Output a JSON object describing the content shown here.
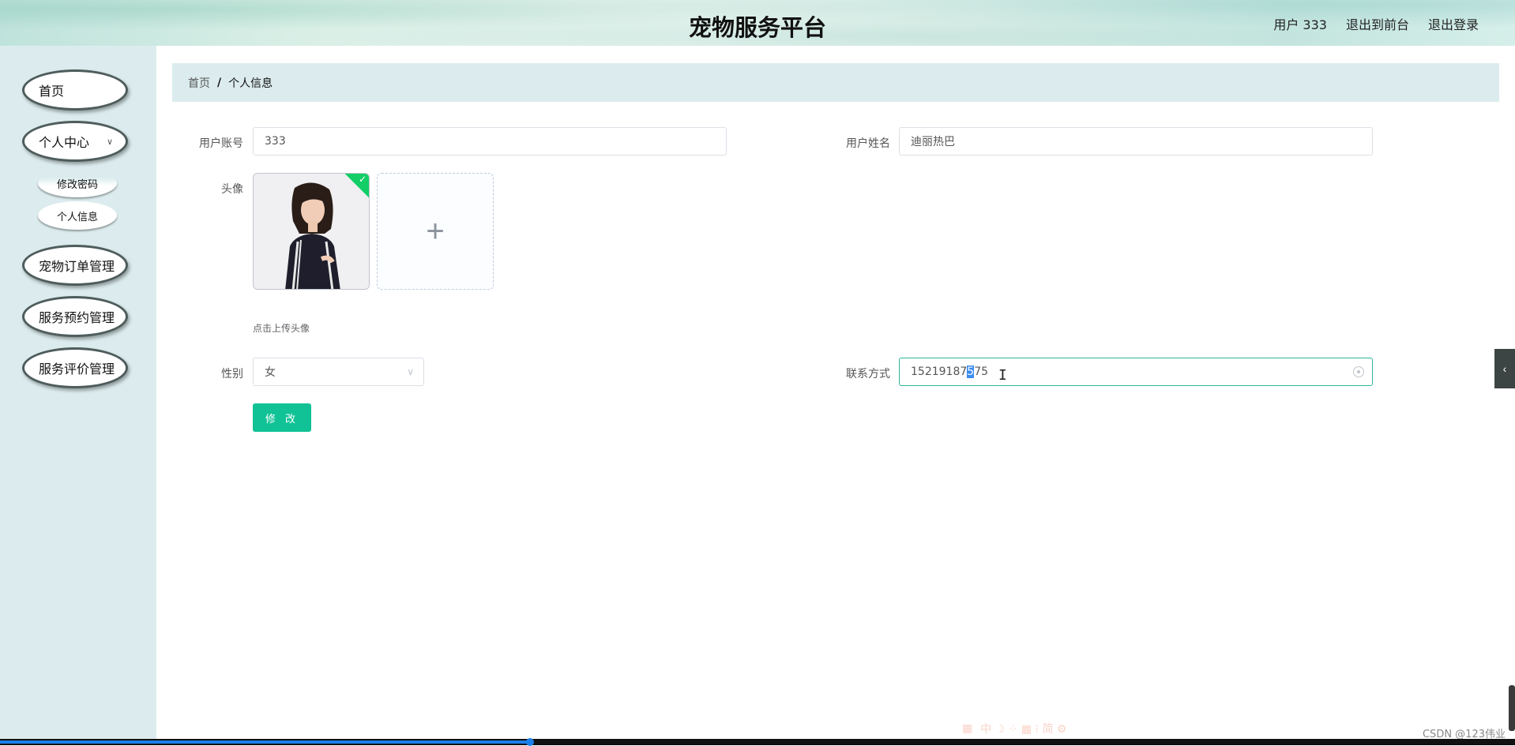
{
  "header": {
    "title": "宠物服务平台",
    "user": "用户 333",
    "to_front": "退出到前台",
    "logout": "退出登录"
  },
  "sidebar": {
    "items": [
      {
        "label": "首页"
      },
      {
        "label": "个人中心",
        "expanded": true,
        "children": [
          {
            "label": "修改密码"
          },
          {
            "label": "个人信息"
          }
        ]
      },
      {
        "label": "宠物订单管理"
      },
      {
        "label": "服务预约管理"
      },
      {
        "label": "服务评价管理"
      }
    ]
  },
  "breadcrumb": {
    "home": "首页",
    "separator": "/",
    "current": "个人信息"
  },
  "form": {
    "account_label": "用户账号",
    "account_value": "333",
    "name_label": "用户姓名",
    "name_value": "迪丽热巴",
    "avatar_label": "头像",
    "upload_tip": "点击上传头像",
    "gender_label": "性别",
    "gender_value": "女",
    "phone_label": "联系方式",
    "phone_before": "15219187",
    "phone_selected": "5",
    "phone_after": "75",
    "submit_label": "修 改"
  },
  "overlay": {
    "ime_glyphs": "中 ☽ ⁘ ▦ ⁝ 简 ⚙",
    "watermark": "CSDN @123伟业"
  },
  "video_progress": 0.35,
  "colors": {
    "accent": "#10c295",
    "sidebar_bg": "#dcecee",
    "selection": "#3b8cf0",
    "upload_success": "#13ce66"
  }
}
